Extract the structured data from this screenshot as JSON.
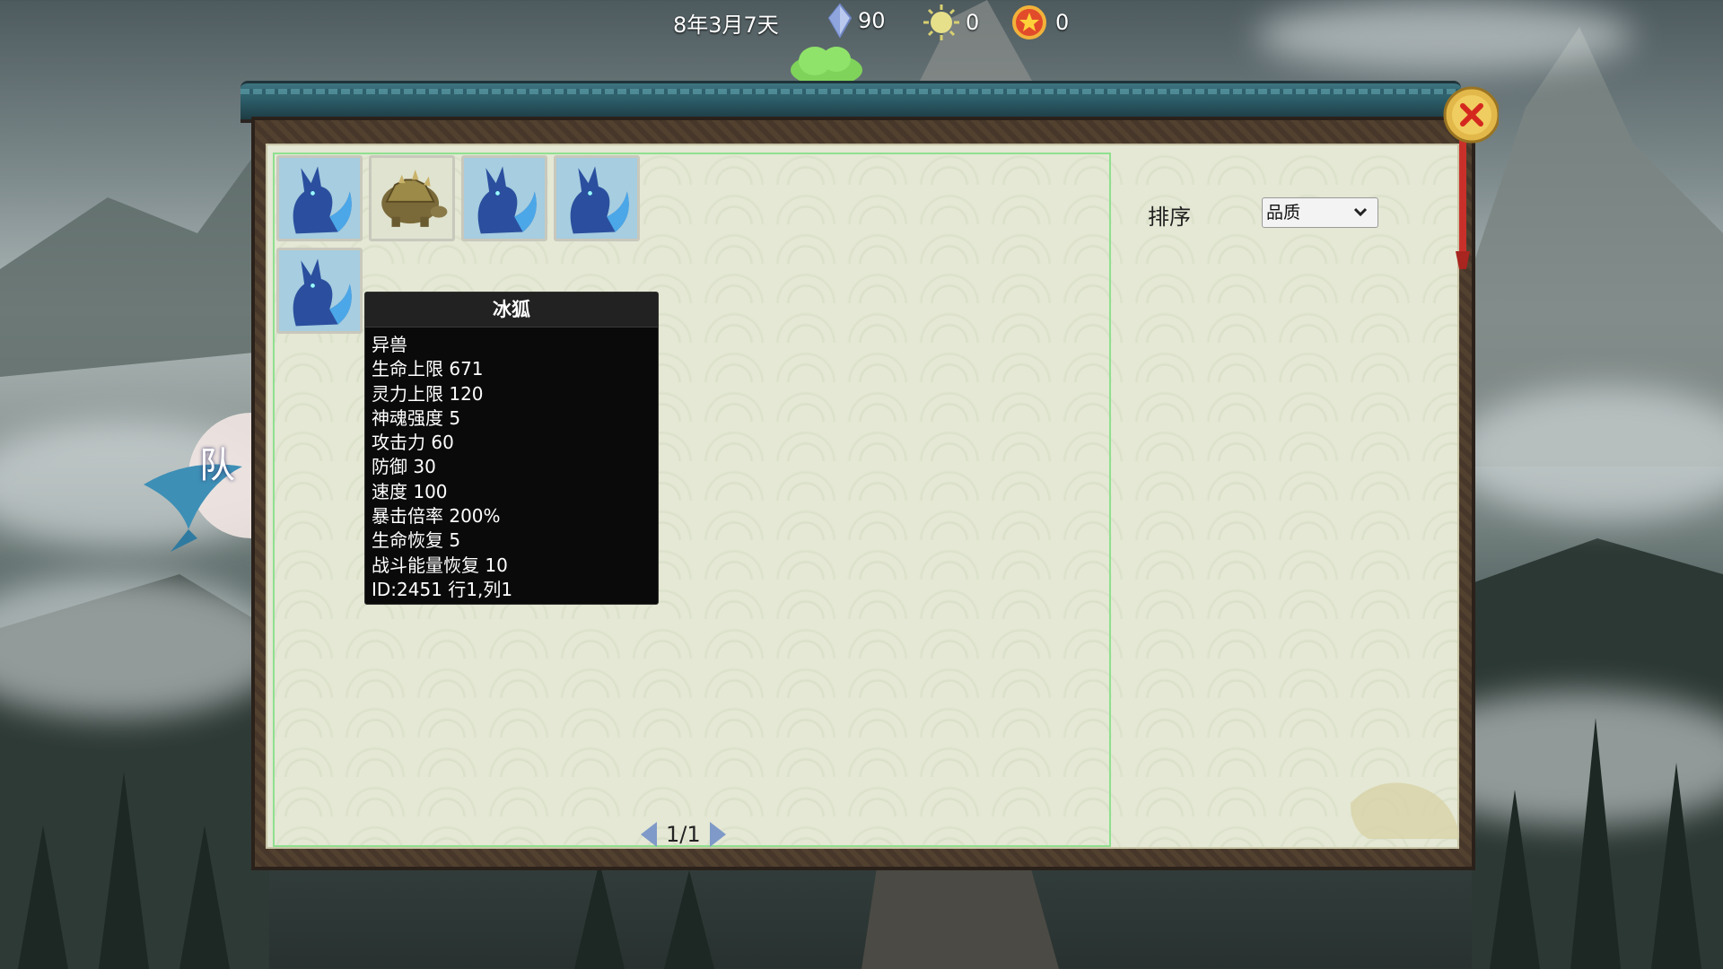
{
  "hud": {
    "date": "8年3月7天",
    "spirit_stones": "90",
    "sun_points": "0",
    "medals": "0"
  },
  "side": {
    "team_label": "队"
  },
  "pets": [
    {
      "name": "ice-fox",
      "icon": "ice-fox-icon"
    },
    {
      "name": "turtle",
      "icon": "turtle-icon"
    },
    {
      "name": "ice-fox",
      "icon": "ice-fox-icon"
    },
    {
      "name": "ice-fox",
      "icon": "ice-fox-icon"
    },
    {
      "name": "ice-fox",
      "icon": "ice-fox-icon"
    }
  ],
  "tooltip": {
    "title": "冰狐",
    "lines": [
      "异兽",
      "生命上限 671",
      "灵力上限 120",
      "神魂强度 5",
      "攻击力 60",
      "防御 30",
      "速度 100",
      "暴击倍率 200%",
      "生命恢复 5",
      "战斗能量恢复 10",
      "ID:2451 行1,列1"
    ]
  },
  "pager": {
    "text": "1/1"
  },
  "sort": {
    "label": "排序",
    "selected": "品质"
  },
  "colors": {
    "panel_bg": "#e4e8d4",
    "grid_border": "#8fe08f",
    "tooltip_bg": "#0a0a0a",
    "frame_teal": "#2a5a66"
  }
}
